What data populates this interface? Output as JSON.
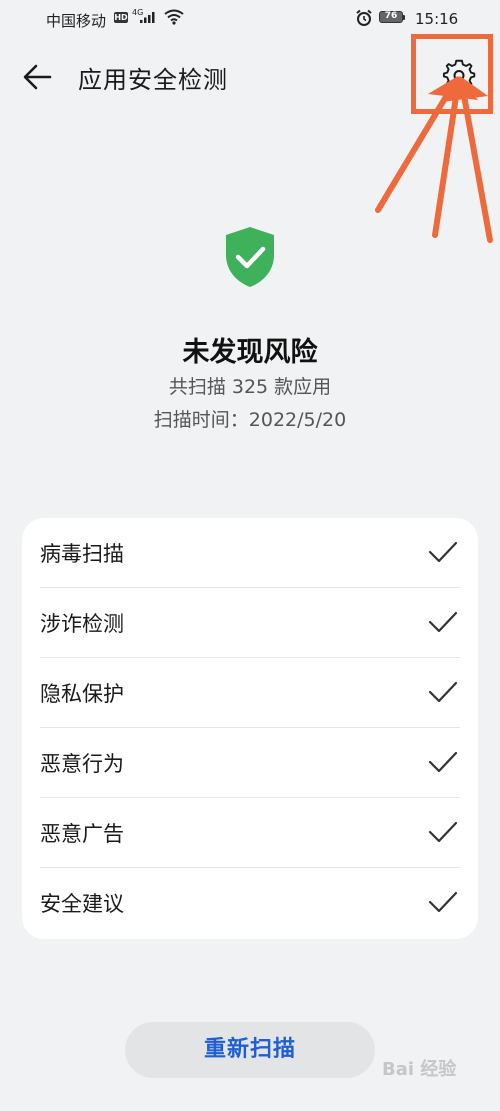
{
  "status_bar": {
    "carrier": "中国移动",
    "hd": "HD",
    "network": "4G",
    "battery": "76",
    "time": "15:16"
  },
  "header": {
    "title": "应用安全检测",
    "back_icon": "back-arrow-icon",
    "settings_icon": "gear-icon"
  },
  "summary": {
    "status_icon": "shield-check-icon",
    "status_color": "#3fb15a",
    "result": "未发现风险",
    "scan_count": "共扫描 325 款应用",
    "scan_time": "扫描时间：2022/5/20"
  },
  "checks": [
    {
      "label": "病毒扫描",
      "done": true
    },
    {
      "label": "涉诈检测",
      "done": true
    },
    {
      "label": "隐私保护",
      "done": true
    },
    {
      "label": "恶意行为",
      "done": true
    },
    {
      "label": "恶意广告",
      "done": true
    },
    {
      "label": "安全建议",
      "done": true
    }
  ],
  "footer": {
    "rescan_label": "重新扫描",
    "accent": "#1f5fd1"
  },
  "annotation": {
    "color": "#ee6a3c"
  },
  "watermark": "Bai 经验"
}
